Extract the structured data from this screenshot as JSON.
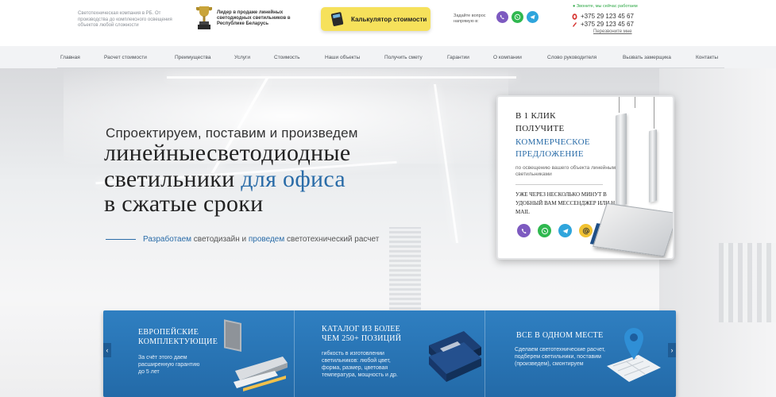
{
  "header": {
    "company_desc": "Светотехническая компания в РБ. От производства до комплексного освещения объектов любой сложности",
    "leader_text": "Лидер в продаже линейных светодиодных светильников в Республике Беларусь",
    "calc_label": "Калькулятор стоимости",
    "ask_text": "Задайте вопрос напрямую в:",
    "status": "● Звоните, мы сейчас работаем",
    "phone_1": "+375 29 123 45 67",
    "phone_2": "+375 29 123 45 67",
    "callback": "Перезвоните мне"
  },
  "nav": [
    "Главная",
    "Расчет стоимости",
    "Преимущества",
    "Услуги",
    "Стоимость",
    "Наши объекты",
    "Получить смету",
    "Гарантии",
    "О компании",
    "Слово руководителя",
    "Вызвать замерщика",
    "Контакты"
  ],
  "hero": {
    "line1": "Спроектируем, поставим и произведем",
    "line2": "линейныесветодиодные",
    "line3_a": "светильники ",
    "line3_b": "для офиса",
    "line4": "в сжатые сроки",
    "sub_a": "Разработаем",
    "sub_b": " светодизайн и ",
    "sub_c": "проведем",
    "sub_d": " светотехнический расчет"
  },
  "offer": {
    "line1": "В 1 КЛИК",
    "line2": "ПОЛУЧИТЕ",
    "line3": "КОММЕРЧЕСКОЕ",
    "line4": "ПРЕДЛОЖЕНИЕ",
    "desc": "по освещению вашего объекта линейными светильниками",
    "cta": "УЖЕ ЧЕРЕЗ НЕСКОЛЬКО МИНУТ В УДОБНЫЙ ВАМ МЕССЕНДЖЕР ИЛИ НА E-MAIL"
  },
  "features": [
    {
      "title": "ЕВРОПЕЙСКИЕ КОМПЛЕКТУЮЩИЕ",
      "text": "За счёт этого даем расширенную гарантию до 5 лет"
    },
    {
      "title": "КАТАЛОГ ИЗ БОЛЕЕ ЧЕМ 250+ ПОЗИЦИЙ",
      "text": "гибкость в изготовлении светильников: любой цвет, форма, размер, цветовая температура, мощность и др."
    },
    {
      "title": "ВСЕ В ОДНОМ МЕСТЕ",
      "text": "Сделаем светотехнические расчет, подберем светильники, поставим (произведем), смонтируем"
    }
  ],
  "arrows": {
    "prev": "‹",
    "next": "›"
  },
  "colors": {
    "accent_blue": "#2a6ca8",
    "calc_yellow": "#f6e15b",
    "panel_blue": "#2f7fc1",
    "status_green": "#2ea846"
  },
  "icons": {
    "messengers": [
      "viber-icon",
      "whatsapp-icon",
      "telegram-icon"
    ],
    "offer_messengers": [
      "viber-icon",
      "whatsapp-icon",
      "telegram-icon",
      "email-icon"
    ]
  }
}
